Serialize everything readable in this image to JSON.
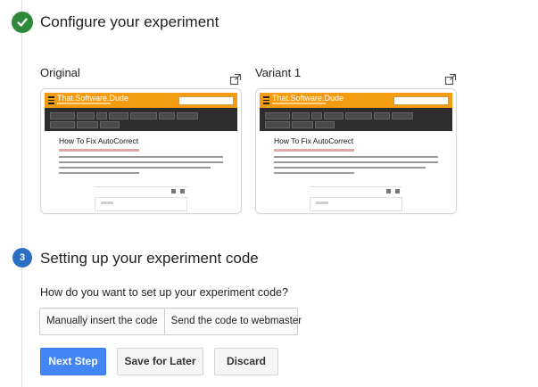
{
  "steps": {
    "configure": {
      "title": "Configure your experiment",
      "status": "complete"
    },
    "setup": {
      "number": "3",
      "title": "Setting up your experiment code"
    }
  },
  "variants": [
    {
      "label": "Original"
    },
    {
      "label": "Variant 1"
    }
  ],
  "preview": {
    "brand": "That.Software.Dude",
    "article_title": "How To Fix AutoCorrect"
  },
  "setup": {
    "question": "How do you want to set up your experiment code?",
    "options": [
      "Manually insert the code",
      "Send the code to webmaster"
    ]
  },
  "actions": {
    "next": "Next Step",
    "save": "Save for Later",
    "discard": "Discard"
  },
  "colors": {
    "complete_green": "#2e8a3a",
    "step_blue": "#2b6fc5",
    "primary_blue": "#4285f4",
    "site_orange": "#f39c12",
    "site_nav": "#2d2d2d"
  }
}
